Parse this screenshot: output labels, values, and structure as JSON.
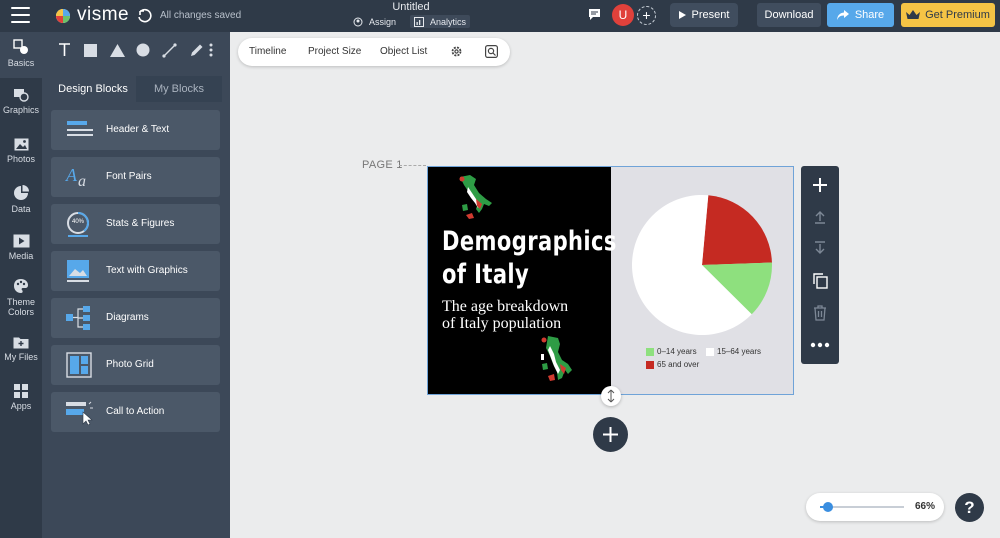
{
  "topbar": {
    "logo_text": "visme",
    "save_status": "All changes saved",
    "doc_title": "Untitled",
    "assign_label": "Assign",
    "analytics_label": "Analytics",
    "avatar_initial": "U",
    "present_label": "Present",
    "download_label": "Download",
    "share_label": "Share",
    "premium_label": "Get Premium"
  },
  "rail": {
    "items": [
      {
        "label": "Basics",
        "icon": "basics-icon"
      },
      {
        "label": "Graphics",
        "icon": "graphics-icon"
      },
      {
        "label": "Photos",
        "icon": "photos-icon"
      },
      {
        "label": "Data",
        "icon": "data-icon"
      },
      {
        "label": "Media",
        "icon": "media-icon"
      },
      {
        "label": "Theme Colors",
        "icon": "palette-icon"
      },
      {
        "label": "My Files",
        "icon": "folder-icon"
      },
      {
        "label": "Apps",
        "icon": "apps-icon"
      }
    ]
  },
  "panel": {
    "tabs": [
      {
        "label": "Design Blocks"
      },
      {
        "label": "My Blocks"
      }
    ],
    "blocks": [
      {
        "label": "Header & Text"
      },
      {
        "label": "Font Pairs"
      },
      {
        "label": "Stats & Figures"
      },
      {
        "label": "Text with Graphics"
      },
      {
        "label": "Diagrams"
      },
      {
        "label": "Photo Grid"
      },
      {
        "label": "Call to Action"
      }
    ],
    "stat_icon_text": "40%"
  },
  "canvas_toolbar": {
    "timeline_label": "Timeline",
    "project_size_label": "Project Size",
    "object_list_label": "Object List"
  },
  "page": {
    "label": "PAGE 1",
    "title_line1": "Demographics",
    "title_line2": "of Italy",
    "subtitle_line1": "The age breakdown",
    "subtitle_line2": "of Italy population"
  },
  "chart_data": {
    "type": "pie",
    "slices": [
      {
        "label": "0–14 years",
        "value": 13,
        "color": "#8ee07e"
      },
      {
        "label": "15–64 years",
        "value": 64,
        "color": "#ffffff"
      },
      {
        "label": "65 and over",
        "value": 23,
        "color": "#c52a22"
      }
    ],
    "legend_position": "bottom"
  },
  "zoom": {
    "value_label": "66%",
    "level": 0.09
  },
  "help_label": "?",
  "colors": {
    "dark": "#2f3a48",
    "accent_blue": "#57a8ea",
    "premium_yellow": "#f5c445",
    "avatar_red": "#e0413b"
  }
}
